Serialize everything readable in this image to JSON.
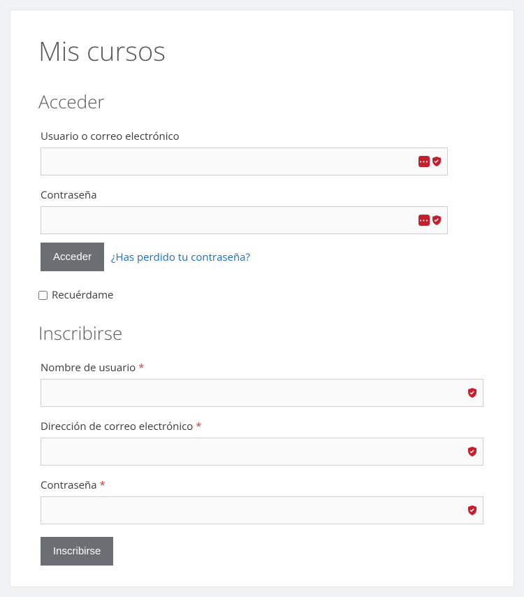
{
  "page": {
    "title": "Mis cursos"
  },
  "login": {
    "heading": "Acceder",
    "username": {
      "label": "Usuario o correo electrónico",
      "value": ""
    },
    "password": {
      "label": "Contraseña",
      "value": ""
    },
    "submit_label": "Acceder",
    "lost_password_label": "¿Has perdido tu contraseña?",
    "remember": {
      "label": "Recuérdame",
      "checked": false
    }
  },
  "register": {
    "heading": "Inscribirse",
    "username": {
      "label": "Nombre de usuario",
      "required": true,
      "value": ""
    },
    "email": {
      "label": "Dirección de correo electrónico",
      "required": true,
      "value": ""
    },
    "password": {
      "label": "Contraseña",
      "required": true,
      "value": ""
    },
    "submit_label": "Inscribirse"
  },
  "required_marker": "*",
  "colors": {
    "accent_link": "#1a6fc4",
    "button_bg": "#6b6e72",
    "required": "#d63638",
    "badge_red": "#c51f2d"
  }
}
